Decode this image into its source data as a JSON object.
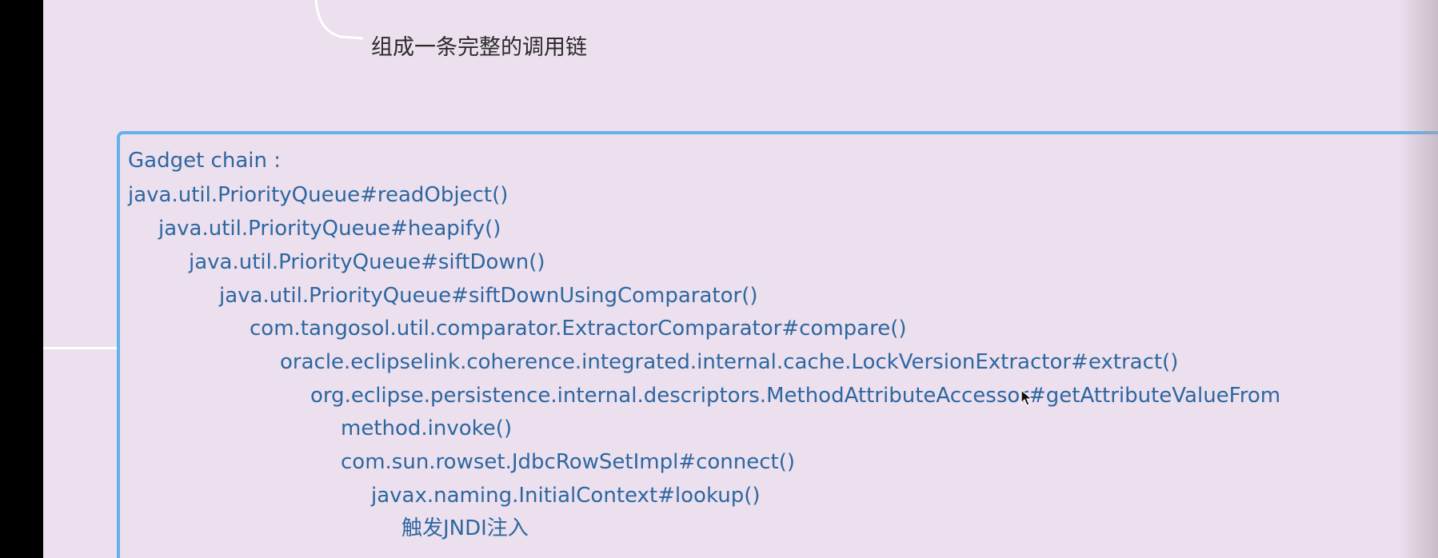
{
  "node": {
    "label": "组成一条完整的调用链"
  },
  "gadget_chain": {
    "header": "Gadget chain :",
    "lines": [
      "java.util.PriorityQueue#readObject()",
      "java.util.PriorityQueue#heapify()",
      "java.util.PriorityQueue#siftDown()",
      "java.util.PriorityQueue#siftDownUsingComparator()",
      "com.tangosol.util.comparator.ExtractorComparator#compare()",
      "oracle.eclipselink.coherence.integrated.internal.cache.LockVersionExtractor#extract()",
      "org.eclipse.persistence.internal.descriptors.MethodAttributeAccessor#getAttributeValueFrom",
      "method.invoke()",
      "com.sun.rowset.JdbcRowSetImpl#connect()",
      "javax.naming.InitialContext#lookup()",
      "触发JNDI注入"
    ]
  },
  "colors": {
    "background": "#ecdfee",
    "box_border": "#63b0ea",
    "code_text": "#2d67a0",
    "label_text": "#2a2a2a"
  },
  "icons": {
    "cursor": "mouse-pointer-icon"
  }
}
